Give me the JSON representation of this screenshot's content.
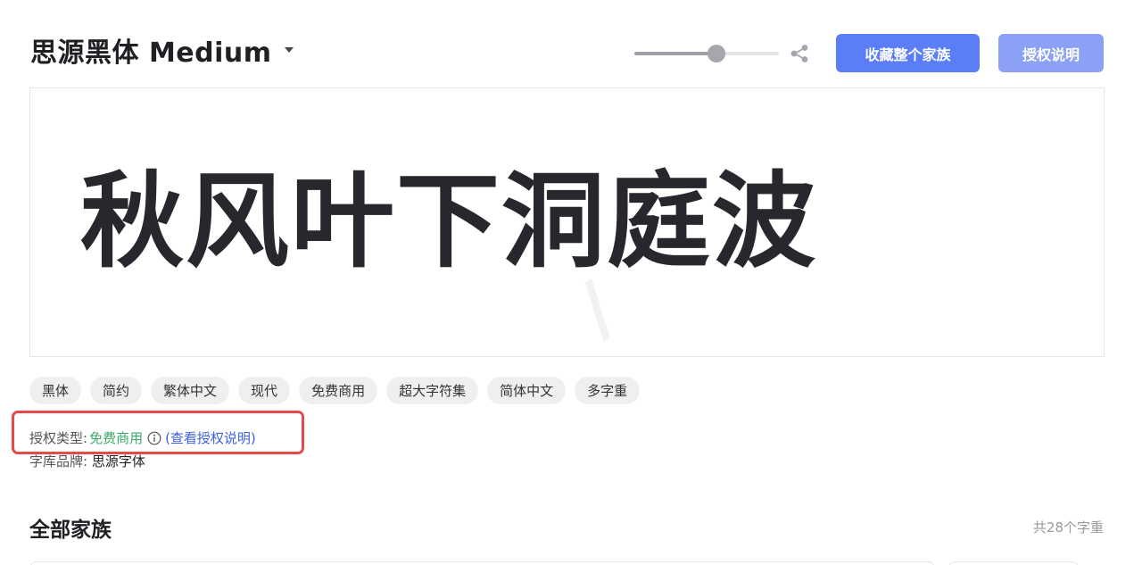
{
  "header": {
    "font_name": "思源黑体 Medium",
    "size_slider_percent": 57,
    "buttons": {
      "favorite_family": "收藏整个家族",
      "license_info": "授权说明"
    }
  },
  "preview": {
    "text": "秋风叶下洞庭波"
  },
  "tags": [
    "黑体",
    "简约",
    "繁体中文",
    "现代",
    "免费商用",
    "超大字符集",
    "简体中文",
    "多字重"
  ],
  "license": {
    "label": "授权类型:",
    "type": "免费商用",
    "link": "(查看授权说明)"
  },
  "brand": {
    "label": "字库品牌:",
    "value": "思源字体"
  },
  "family": {
    "title": "全部家族",
    "count": "共28个字重"
  },
  "colors": {
    "accent": "#5b7df5",
    "accent_light": "#8ba1f5",
    "free_green": "#3faa6a",
    "link_blue": "#3a62e6",
    "highlight_red": "#e84a4a"
  },
  "icons": {
    "caret": "caret-down-icon",
    "share": "share-icon",
    "info": "info-icon"
  }
}
